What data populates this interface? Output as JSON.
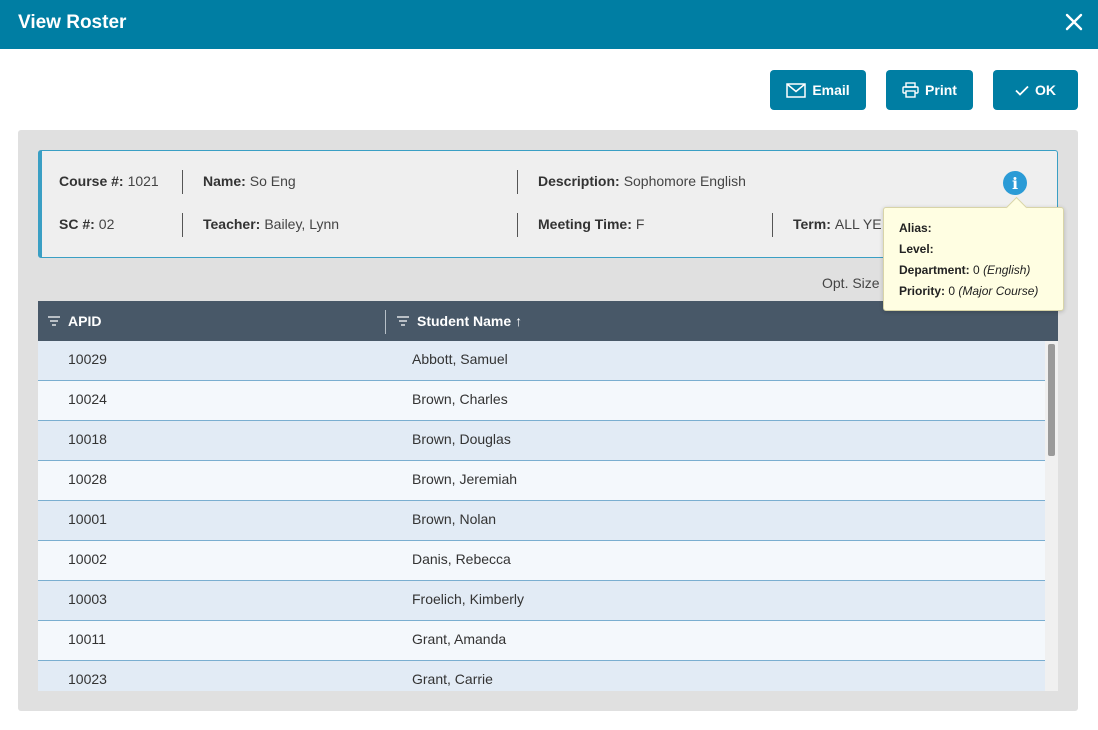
{
  "dialog": {
    "title": "View Roster",
    "close_icon": "close-icon"
  },
  "toolbar": {
    "email_label": "Email",
    "print_label": "Print",
    "ok_label": "OK"
  },
  "course": {
    "course_num_label": "Course #:",
    "course_num": "1021",
    "name_label": "Name:",
    "name": "So Eng",
    "description_label": "Description:",
    "description": "Sophomore English",
    "sc_label": "SC #:",
    "sc": "02",
    "teacher_label": "Teacher:",
    "teacher": "Bailey, Lynn",
    "meeting_time_label": "Meeting Time:",
    "meeting_time": "F",
    "term_label": "Term:",
    "term": "ALL YE"
  },
  "opt_size_label": "Opt. Size",
  "tooltip": {
    "alias_label": "Alias:",
    "level_label": "Level:",
    "department_label": "Department:",
    "department_value": "0",
    "department_note": "(English)",
    "priority_label": "Priority:",
    "priority_value": "0",
    "priority_note": "(Major Course)"
  },
  "grid": {
    "columns": [
      "APID",
      "Student Name"
    ],
    "sort_indicator": "↑",
    "rows": [
      {
        "apid": "10029",
        "name": "Abbott, Samuel"
      },
      {
        "apid": "10024",
        "name": "Brown, Charles"
      },
      {
        "apid": "10018",
        "name": "Brown, Douglas"
      },
      {
        "apid": "10028",
        "name": "Brown, Jeremiah"
      },
      {
        "apid": "10001",
        "name": "Brown, Nolan"
      },
      {
        "apid": "10002",
        "name": "Danis, Rebecca"
      },
      {
        "apid": "10003",
        "name": "Froelich, Kimberly"
      },
      {
        "apid": "10011",
        "name": "Grant, Amanda"
      },
      {
        "apid": "10023",
        "name": "Grant, Carrie"
      }
    ]
  },
  "colors": {
    "titlebar": "#007ea3",
    "button": "#007ea3",
    "grid_header": "#485868",
    "row_odd": "#e2ebf5",
    "row_even": "#f4f8fc",
    "info_icon": "#2b9bd6",
    "tooltip_bg": "#fffee2"
  }
}
